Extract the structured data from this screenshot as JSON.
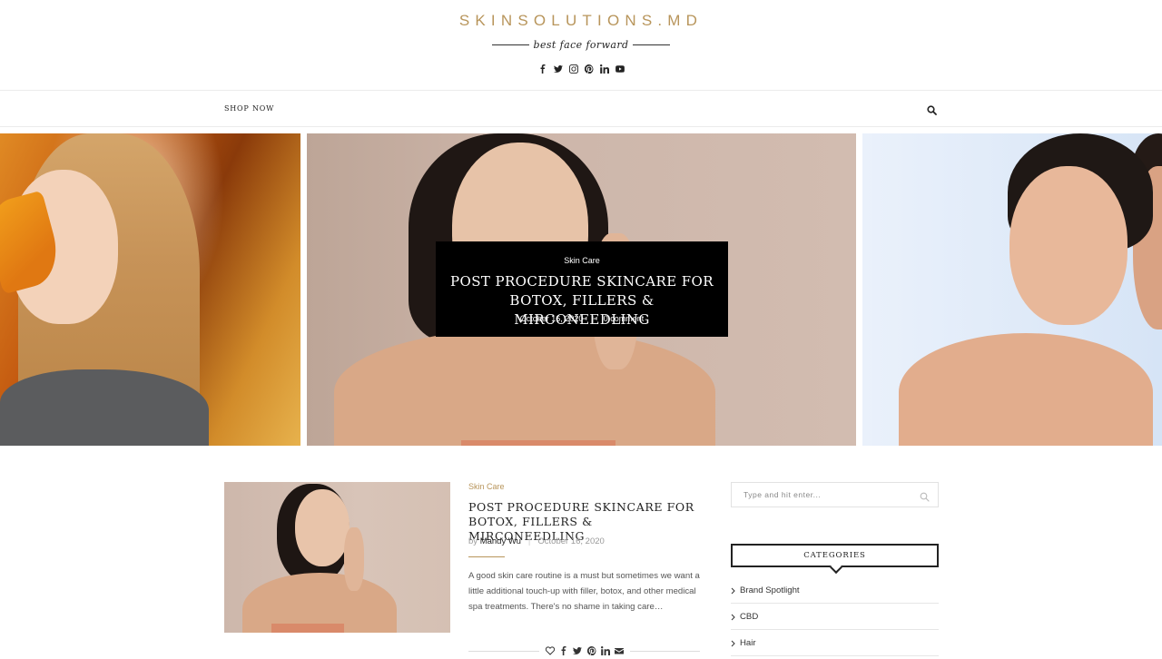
{
  "header": {
    "logo": "SKINSOLUTIONS.MD",
    "tagline": "best face forward",
    "social_icons": [
      "facebook-icon",
      "twitter-icon",
      "instagram-icon",
      "pinterest-icon",
      "linkedin-icon",
      "youtube-icon"
    ]
  },
  "nav": {
    "shop_label": "SHOP NOW",
    "search_icon": "search-icon"
  },
  "slider": {
    "caption": {
      "category": "Skin Care",
      "title": "POST PROCEDURE SKINCARE FOR BOTOX, FILLERS & MIRCONEEDLING",
      "date": "October 16, 2020",
      "comments": "0 comment"
    }
  },
  "post": {
    "category": "Skin Care",
    "title": "POST PROCEDURE SKINCARE FOR BOTOX, FILLERS & MIRCONEEDLING",
    "by": "by",
    "author": "Mandy Wu",
    "date": "October 16, 2020",
    "excerpt": "A good skin care routine is a must but sometimes we want a little additional touch-up with filler, botox, and other medical spa treatments. There's no shame in taking care…",
    "share_icons": [
      "heart-icon",
      "facebook-icon",
      "twitter-icon",
      "pinterest-icon",
      "linkedin-icon",
      "email-icon"
    ]
  },
  "sidebar": {
    "search_placeholder": "Type and hit enter...",
    "categories_title": "CATEGORIES",
    "categories": [
      "Brand Spotlight",
      "CBD",
      "Hair"
    ]
  },
  "colors": {
    "accent": "#b8955b",
    "text": "#313131"
  }
}
